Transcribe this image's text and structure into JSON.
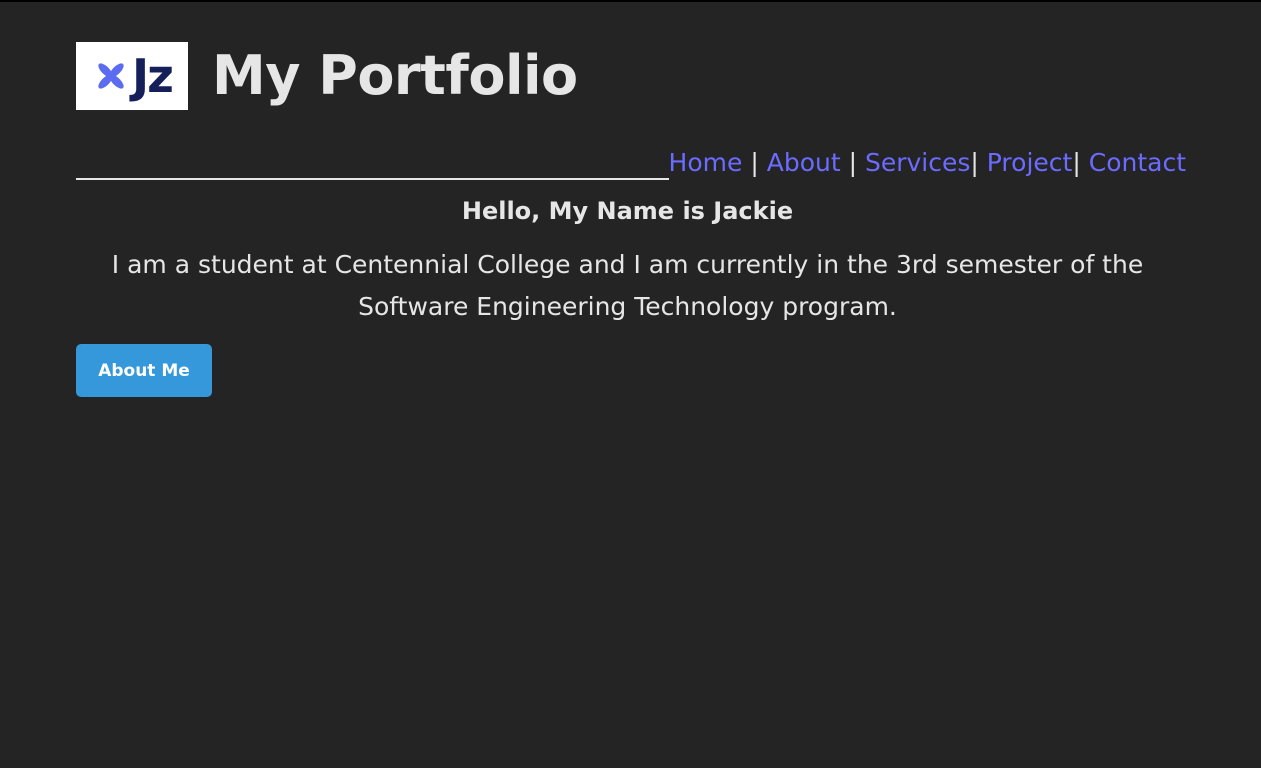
{
  "header": {
    "logo_text": "Jz",
    "title": "My Portfolio"
  },
  "nav": {
    "items": [
      {
        "label": "Home"
      },
      {
        "label": "About"
      },
      {
        "label": "Services"
      },
      {
        "label": "Project"
      },
      {
        "label": "Contact"
      }
    ],
    "separator": "|"
  },
  "main": {
    "greeting": "Hello, My Name is Jackie",
    "intro_line1": "I am a student at Centennial College and I am currently in the 3rd semester of the",
    "intro_line2": "Software Engineering Technology program.",
    "button_label": "About Me"
  },
  "colors": {
    "background": "#242424",
    "text": "#e6e6e6",
    "link": "#6b6bff",
    "button": "#3498db",
    "logo_text": "#15205a",
    "logo_mark": "#5b6cf0"
  }
}
